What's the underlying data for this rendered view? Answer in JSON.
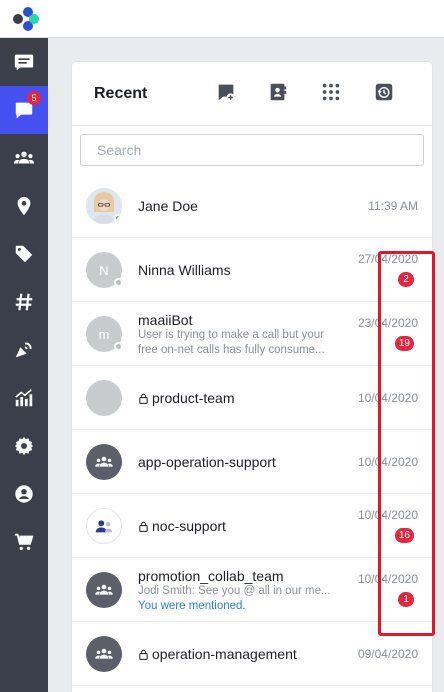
{
  "panel": {
    "title": "Recent",
    "header_icons": [
      "new-chat-icon",
      "contacts-book-icon",
      "apps-grid-icon",
      "history-icon"
    ],
    "search_placeholder": "Search"
  },
  "sidebar": {
    "items": [
      {
        "icon": "message-list-icon",
        "active": false
      },
      {
        "icon": "chat-icon",
        "active": true,
        "badge": "5"
      },
      {
        "icon": "people-icon",
        "active": false
      },
      {
        "icon": "location-pin-icon",
        "active": false
      },
      {
        "icon": "tag-icon",
        "active": false
      },
      {
        "icon": "hashtag-icon",
        "active": false
      },
      {
        "icon": "broadcast-icon",
        "active": false
      },
      {
        "icon": "analytics-icon",
        "active": false
      },
      {
        "icon": "settings-icon",
        "active": false
      },
      {
        "icon": "account-icon",
        "active": false
      },
      {
        "icon": "cart-icon",
        "active": false
      }
    ]
  },
  "conversations": [
    {
      "name": "Jane Doe",
      "time": "11:39 AM",
      "avatar": "photo",
      "status": "online"
    },
    {
      "name": "Ninna Williams",
      "time": "27/04/2020",
      "avatar": "initial",
      "initial": "N",
      "status": "offline",
      "badge": "2"
    },
    {
      "name": "maaiiBot",
      "time": "23/04/2020",
      "avatar": "initial",
      "initial": "m",
      "status": "offline",
      "badge": "19",
      "preview_line1": "User is trying to make a call but your",
      "preview_line2": "free on-net calls has fully consume..."
    },
    {
      "name": "product-team",
      "time": "10/04/2020",
      "avatar": "blank",
      "locked": true
    },
    {
      "name": "app-operation-support",
      "time": "10/04/2020",
      "avatar": "group"
    },
    {
      "name": "noc-support",
      "time": "10/04/2020",
      "avatar": "group-light",
      "locked": true,
      "badge": "16"
    },
    {
      "name": "promotion_collab_team",
      "time": "10/04/2020",
      "avatar": "group",
      "badge": "1",
      "preview_line1": "Jodi Smith: See you @ all in our me...",
      "mention": "You were mentioned."
    },
    {
      "name": "operation-management",
      "time": "09/04/2020",
      "avatar": "group",
      "locked": true
    }
  ],
  "colors": {
    "accent": "#4451ee",
    "sidebar": "#3b3f4a",
    "badge": "#e5263f",
    "online": "#2ec25f",
    "mention": "#2f7fe2",
    "highlight": "#e8142a"
  }
}
